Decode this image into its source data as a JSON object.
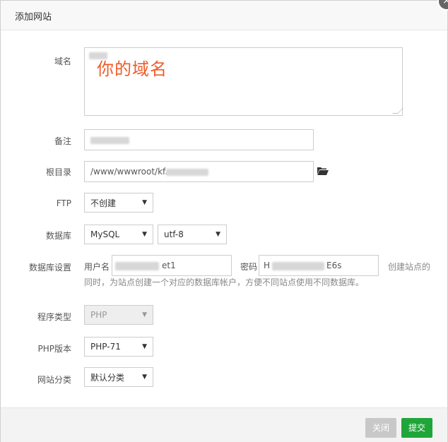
{
  "dialog": {
    "title": "添加网站",
    "close_symbol": "×"
  },
  "annotation": "你的域名",
  "form": {
    "domain_label": "域名",
    "remark_label": "备注",
    "root_label": "根目录",
    "root_value": "/www/wwwroot/kf.",
    "ftp_label": "FTP",
    "ftp_value": "不创建",
    "db_label": "数据库",
    "db_type": "MySQL",
    "db_charset": "utf-8",
    "db_settings_label": "数据库设置",
    "db_user_label": "用户名",
    "db_user_value_suffix": "et1",
    "db_pass_label": "密码",
    "db_pass_value_prefix": "H",
    "db_pass_value_suffix": "E6s",
    "hint_line1": "创建站点的",
    "hint_line2": "同时，为站点创建一个对应的数据库帐户，方便不同站点使用不同数据库。",
    "program_type_label": "程序类型",
    "program_type_value": "PHP",
    "php_version_label": "PHP版本",
    "php_version_value": "PHP-71",
    "site_category_label": "网站分类",
    "site_category_value": "默认分类"
  },
  "footer": {
    "close_label": "关闭",
    "submit_label": "提交"
  },
  "colors": {
    "accent": "#20a53a",
    "annotation": "#f05a28"
  },
  "icons": {
    "folder": "folder-open-icon",
    "caret": "caret-down-icon"
  }
}
